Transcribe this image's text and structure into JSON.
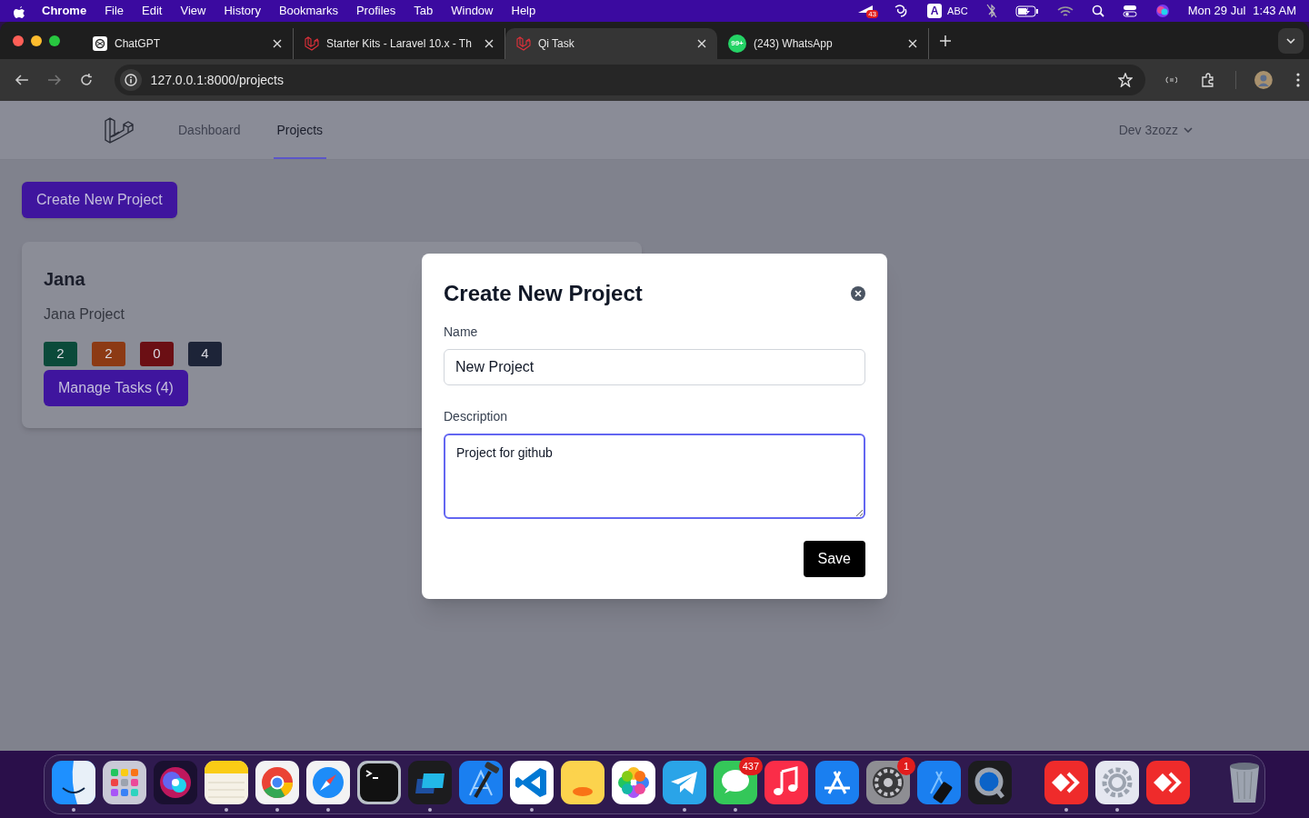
{
  "menu_bar": {
    "app": "Chrome",
    "menus": [
      "File",
      "Edit",
      "View",
      "History",
      "Bookmarks",
      "Profiles",
      "Tab",
      "Window",
      "Help"
    ],
    "notification_count": "43",
    "input_letter": "A",
    "input_source": "ABC",
    "date": "Mon 29 Jul",
    "time": "1:43 AM"
  },
  "tabs": [
    {
      "title": "ChatGPT",
      "selected": false
    },
    {
      "title": "Starter Kits - Laravel 10.x - Th",
      "selected": false
    },
    {
      "title": "Qi Task",
      "selected": true
    },
    {
      "title": "(243) WhatsApp",
      "selected": false,
      "favicon_badge": "99+"
    }
  ],
  "address": "127.0.0.1:8000/projects",
  "nav": {
    "links": [
      {
        "label": "Dashboard",
        "selected": false
      },
      {
        "label": "Projects",
        "selected": true
      }
    ],
    "user": "Dev 3zozz"
  },
  "create_button": "Create New Project",
  "projects": [
    {
      "name": "Jana",
      "description": "Jana Project",
      "counts": [
        {
          "value": "2",
          "color": "#0a4a3a"
        },
        {
          "value": "2",
          "color": "#8c3a14"
        },
        {
          "value": "0",
          "color": "#6b0f14"
        },
        {
          "value": "4",
          "color": "#1d2438"
        }
      ],
      "manage_button": "Manage Tasks (4)"
    }
  ],
  "modal": {
    "title": "Create New Project",
    "fields": [
      {
        "kind": "input",
        "label": "Name",
        "value": "New Project",
        "focused": false
      },
      {
        "kind": "textarea",
        "label": "Description",
        "value": "Project for github",
        "focused": true
      }
    ],
    "save_button": "Save"
  },
  "dock": [
    [
      {
        "running": true
      },
      {
        "running": false
      },
      {
        "running": false
      },
      {
        "running": true
      },
      {
        "running": true
      },
      {
        "running": true
      },
      {
        "running": false
      },
      {
        "running": true
      },
      {
        "running": false
      },
      {
        "running": true
      },
      {
        "running": false
      },
      {
        "running": false
      },
      {
        "running": true
      },
      {
        "running": true,
        "badge": "437"
      },
      {
        "running": false
      },
      {
        "running": false
      },
      {
        "running": false,
        "badge": "1"
      },
      {
        "running": false
      },
      {
        "running": false
      }
    ],
    [
      {
        "running": true
      },
      {
        "running": true
      },
      {
        "running": false
      }
    ],
    [
      {
        "running": false
      }
    ]
  ]
}
